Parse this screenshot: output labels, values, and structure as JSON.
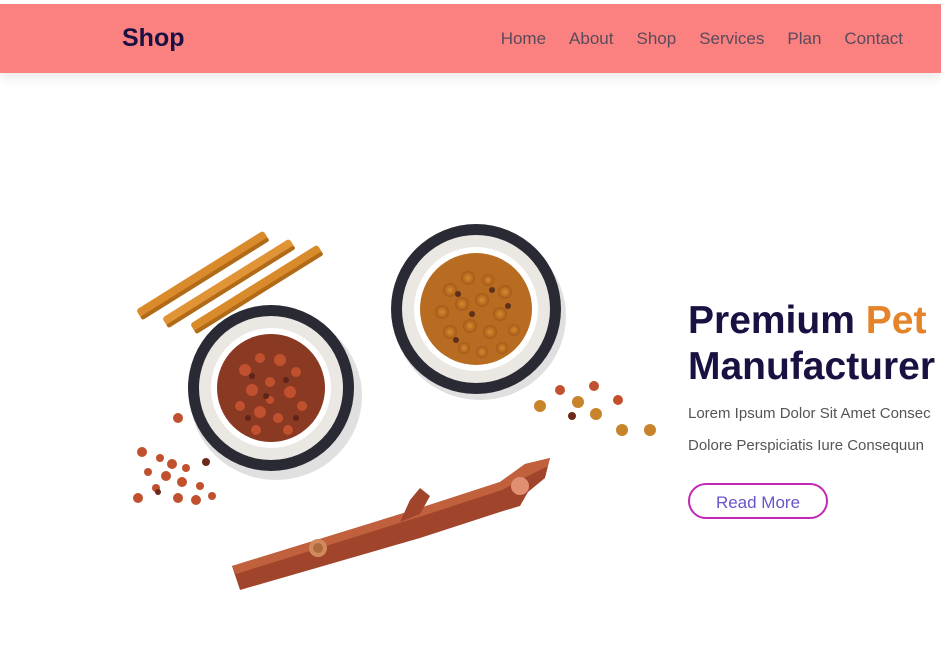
{
  "header": {
    "brand": "Shop",
    "nav": [
      "Home",
      "About",
      "Shop",
      "Services",
      "Plan",
      "Contact"
    ],
    "background_color": "#fb8080"
  },
  "hero": {
    "title_part1": "Premium",
    "title_accent": "Pet",
    "title_line2": "Manufacturer",
    "description_line1": "Lorem Ipsum Dolor Sit Amet Consec",
    "description_line2": "Dolore Perspiciatis Iure Consequun",
    "button_label": "Read More",
    "accent_color": "#e4832a",
    "button_border_color": "#c228b5"
  },
  "image": {
    "subject": "pet food bowls, chew sticks and kibble"
  }
}
